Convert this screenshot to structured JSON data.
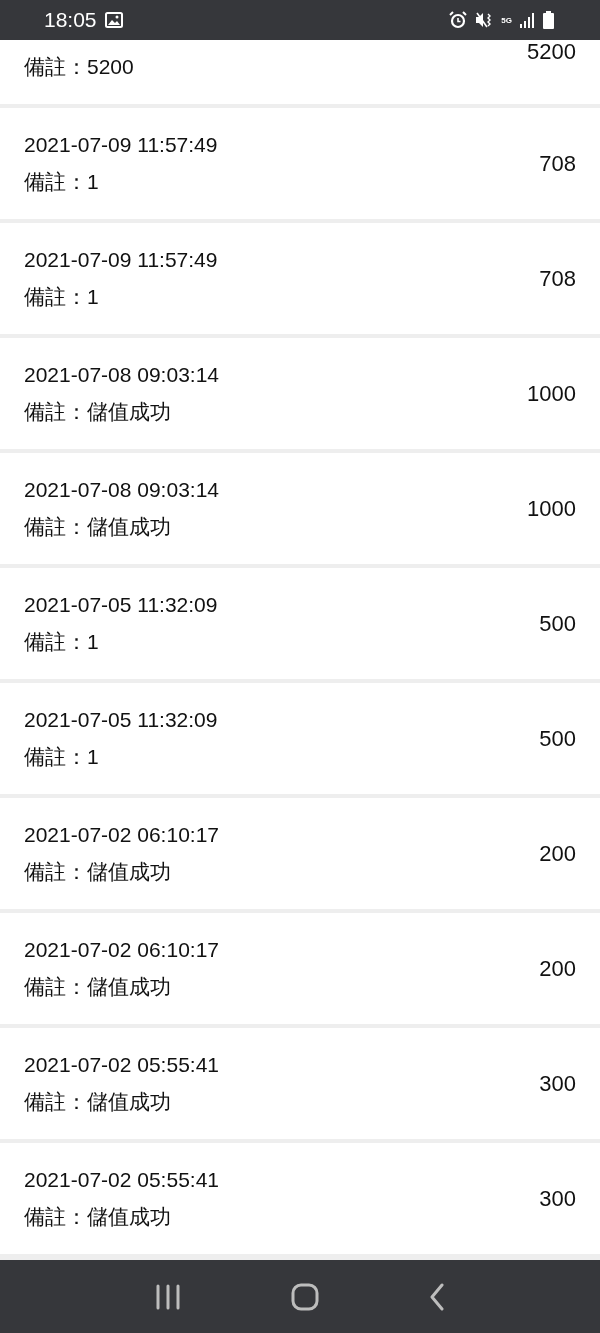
{
  "status_bar": {
    "time": "18:05",
    "network": "5G"
  },
  "records": [
    {
      "note": "備註：5200",
      "amount": "5200"
    },
    {
      "date": "2021-07-09 11:57:49",
      "note": "備註：1",
      "amount": "708"
    },
    {
      "date": "2021-07-09 11:57:49",
      "note": "備註：1",
      "amount": "708"
    },
    {
      "date": "2021-07-08 09:03:14",
      "note": "備註：儲值成功",
      "amount": "1000"
    },
    {
      "date": "2021-07-08 09:03:14",
      "note": "備註：儲值成功",
      "amount": "1000"
    },
    {
      "date": "2021-07-05 11:32:09",
      "note": "備註：1",
      "amount": "500"
    },
    {
      "date": "2021-07-05 11:32:09",
      "note": "備註：1",
      "amount": "500"
    },
    {
      "date": "2021-07-02 06:10:17",
      "note": "備註：儲值成功",
      "amount": "200"
    },
    {
      "date": "2021-07-02 06:10:17",
      "note": "備註：儲值成功",
      "amount": "200"
    },
    {
      "date": "2021-07-02 05:55:41",
      "note": "備註：儲值成功",
      "amount": "300"
    },
    {
      "date": "2021-07-02 05:55:41",
      "note": "備註：儲值成功",
      "amount": "300"
    }
  ]
}
